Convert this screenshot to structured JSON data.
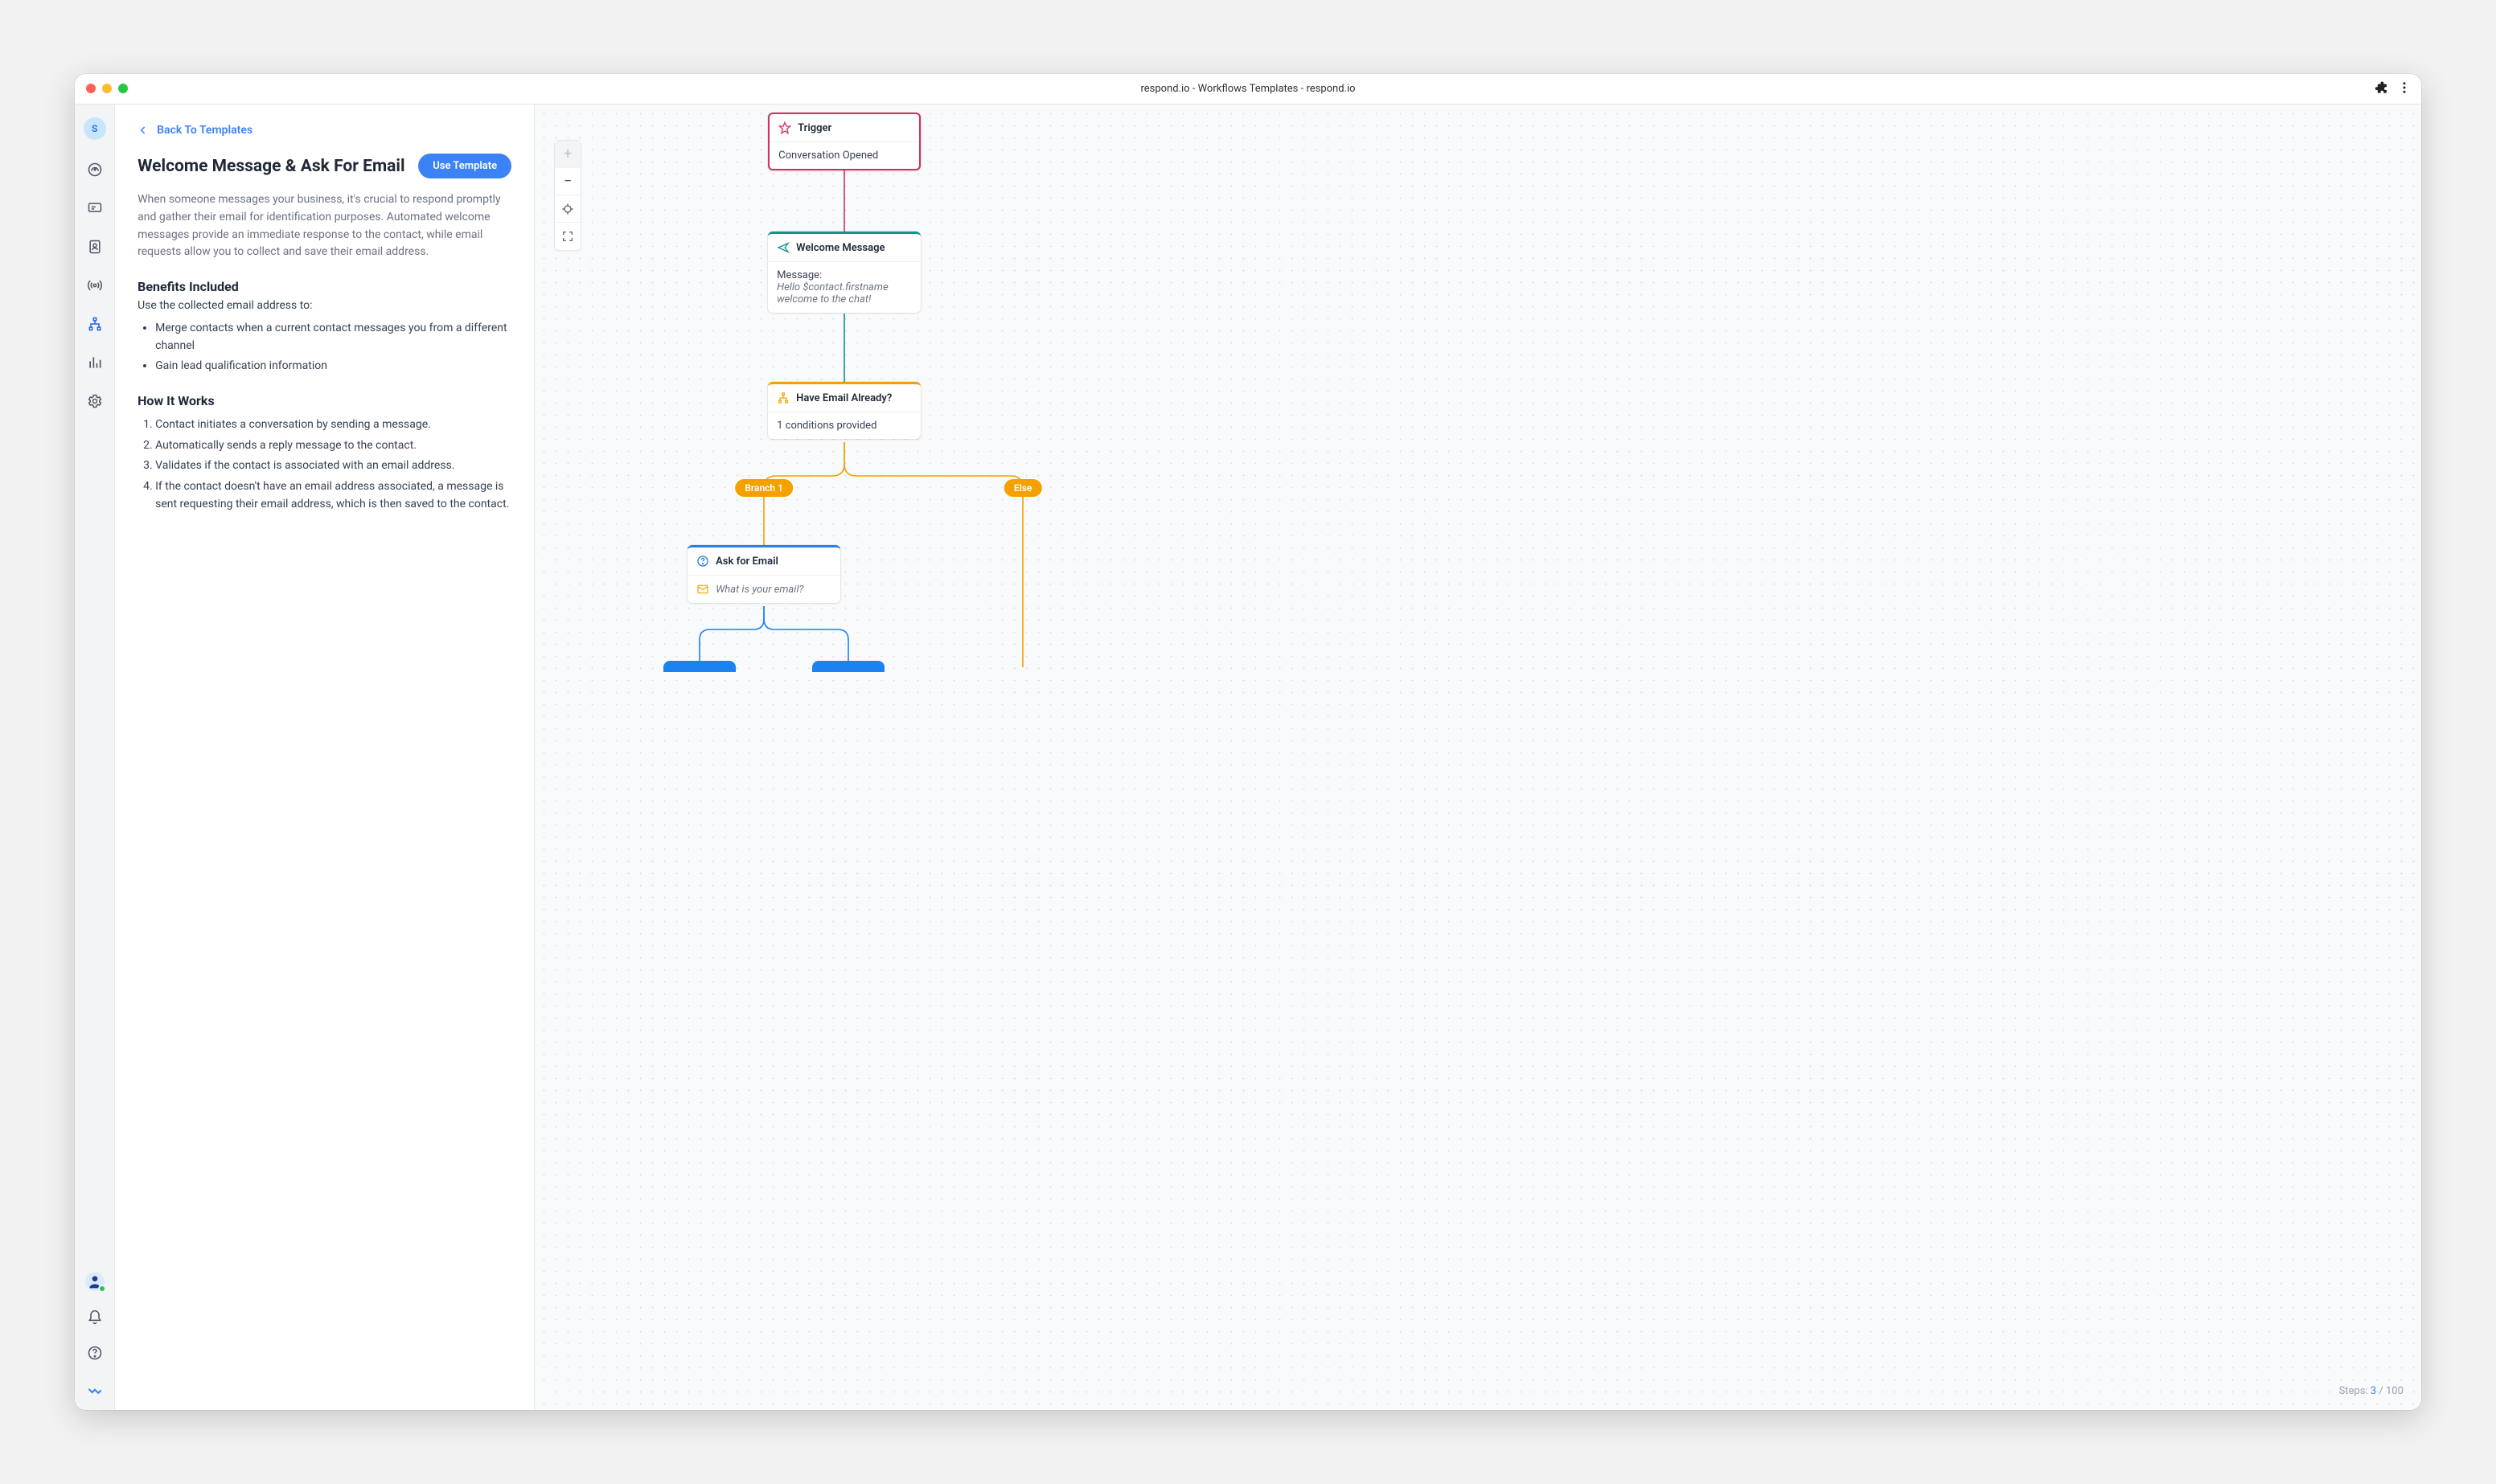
{
  "window_title": "respond.io - Workflows Templates - respond.io",
  "sidebar": {
    "avatar_letter": "S"
  },
  "panel": {
    "back_label": "Back To Templates",
    "title": "Welcome Message & Ask For Email",
    "use_template_label": "Use Template",
    "description": "When someone messages your business, it's crucial to respond promptly and gather their email for identification purposes. Automated welcome messages provide an immediate response to the contact, while email requests allow you to collect and save their email address.",
    "benefits_heading": "Benefits Included",
    "benefits_subtitle": "Use the collected email address to:",
    "benefits": [
      "Merge contacts when a current contact messages you from a different channel",
      "Gain lead qualification information"
    ],
    "how_heading": "How It Works",
    "how_steps": [
      "Contact initiates a conversation by sending a message.",
      "Automatically sends a reply message to the contact.",
      "Validates if the contact is associated with an email address.",
      "If the contact doesn't have an email address associated, a message is sent requesting their email address, which is then saved to the contact."
    ]
  },
  "canvas": {
    "trigger": {
      "title": "Trigger",
      "body": "Conversation Opened"
    },
    "welcome": {
      "title": "Welcome Message",
      "body_label": "Message:",
      "body_text": "Hello $contact.firstname welcome to the chat!"
    },
    "branch": {
      "title": "Have Email Already?",
      "body": "1 conditions provided"
    },
    "branch_pill_1": "Branch 1",
    "branch_pill_2": "Else",
    "ask": {
      "title": "Ask for Email",
      "body": "What is your email?"
    },
    "steps_label": "Steps: ",
    "steps_current": "3",
    "steps_sep": " / ",
    "steps_max": "100"
  }
}
